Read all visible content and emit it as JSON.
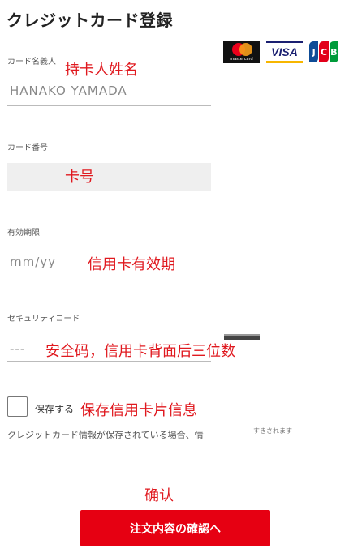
{
  "header": {
    "title": "クレジットカード登録"
  },
  "brands": {
    "mastercard": "mastercard",
    "visa": "VISA",
    "jcb": [
      "J",
      "C",
      "B"
    ]
  },
  "colors": {
    "accent": "#e60012",
    "annotation": "#e0191f"
  },
  "form": {
    "name": {
      "label": "カード名義人",
      "placeholder": "HANAKO YAMADA",
      "annotation": "持卡人姓名"
    },
    "number": {
      "label": "カード番号",
      "annotation": "卡号"
    },
    "expiry": {
      "label": "有効期限",
      "placeholder": "mm/yy",
      "annotation": "信用卡有效期"
    },
    "cvc": {
      "label": "セキュリティコード",
      "placeholder": "---",
      "annotation": "安全码，信用卡背面后三位数"
    },
    "save": {
      "label": "保存する",
      "annotation": "保存信用卡片信息"
    },
    "note": "クレジットカード情報が保存されている場合、情",
    "note_tail": "すきされます"
  },
  "confirm": {
    "annotation": "确认",
    "button_label": "注文内容の確認へ"
  }
}
